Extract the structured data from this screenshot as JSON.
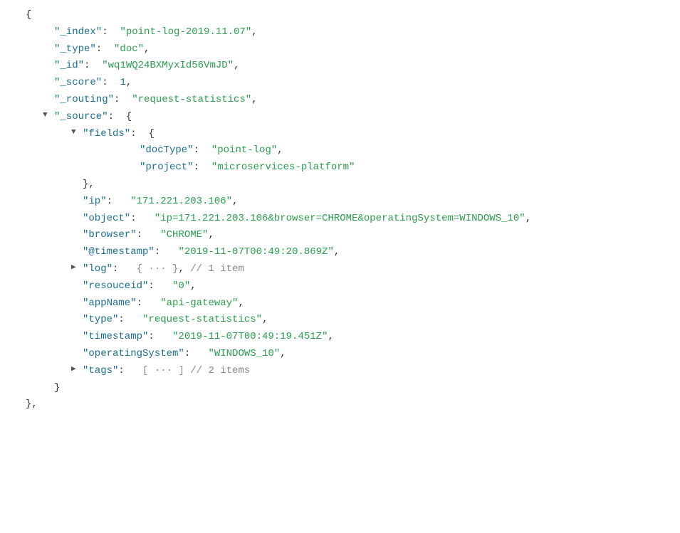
{
  "json": {
    "opening_brace": "{",
    "closing_brace": "}",
    "closing_comma": "},",
    "fields": {
      "index_key": "\"_index\"",
      "index_colon": ":",
      "index_value": "\"point-log-2019.11.07\"",
      "index_comma": ",",
      "type_key": "\"_type\"",
      "type_colon": ":",
      "type_value": "\"doc\"",
      "type_comma": ",",
      "id_key": "\"_id\"",
      "id_colon": ":",
      "id_value": "\"wq1WQ24BXMyxId56VmJD\"",
      "id_comma": ",",
      "score_key": "\"_score\"",
      "score_colon": ":",
      "score_value": "1",
      "score_comma": ",",
      "routing_key": "\"_routing\"",
      "routing_colon": ":",
      "routing_value": "\"request-statistics\"",
      "routing_comma": ",",
      "source_key": "\"_source\"",
      "source_colon": ":",
      "source_open": "{",
      "fields_key": "\"fields\"",
      "fields_colon": ":",
      "fields_open": "{",
      "docType_key": "\"docType\"",
      "docType_colon": ":",
      "docType_value": "\"point-log\"",
      "docType_comma": ",",
      "project_key": "\"project\"",
      "project_colon": ":",
      "project_value": "\"microservices-platform\"",
      "fields_close": "},",
      "ip_key": "\"ip\"",
      "ip_colon": ":",
      "ip_value": "\"171.221.203.106\"",
      "ip_comma": ",",
      "object_key": "\"object\"",
      "object_colon": ":",
      "object_value": "\"ip=171.221.203.106&browser=CHROME&operatingSystem=WINDOWS_10\"",
      "object_comma": ",",
      "browser_key": "\"browser\"",
      "browser_colon": ":",
      "browser_value": "\"CHROME\"",
      "browser_comma": ",",
      "timestamp_key": "\"@timestamp\"",
      "timestamp_colon": ":",
      "timestamp_value": "\"2019-11-07T00:49:20.869Z\"",
      "timestamp_comma": ",",
      "log_key": "\"log\"",
      "log_colon": ":",
      "log_collapsed": "{ ··· }",
      "log_comment": "// 1 item",
      "log_comma": ",",
      "resouceid_key": "\"resouceid\"",
      "resouceid_colon": ":",
      "resouceid_value": "\"0\"",
      "resouceid_comma": ",",
      "appName_key": "\"appName\"",
      "appName_colon": ":",
      "appName_value": "\"api-gateway\"",
      "appName_comma": ",",
      "type2_key": "\"type\"",
      "type2_colon": ":",
      "type2_value": "\"request-statistics\"",
      "type2_comma": ",",
      "timestamp2_key": "\"timestamp\"",
      "timestamp2_colon": ":",
      "timestamp2_value": "\"2019-11-07T00:49:19.451Z\"",
      "timestamp2_comma": ",",
      "operatingSystem_key": "\"operatingSystem\"",
      "operatingSystem_colon": ":",
      "operatingSystem_value": "\"WINDOWS_10\"",
      "operatingSystem_comma": ",",
      "tags_key": "\"tags\"",
      "tags_colon": ":",
      "tags_collapsed": "[ ··· ]",
      "tags_comment": "// 2 items",
      "source_close": "}",
      "root_close": "}"
    }
  }
}
